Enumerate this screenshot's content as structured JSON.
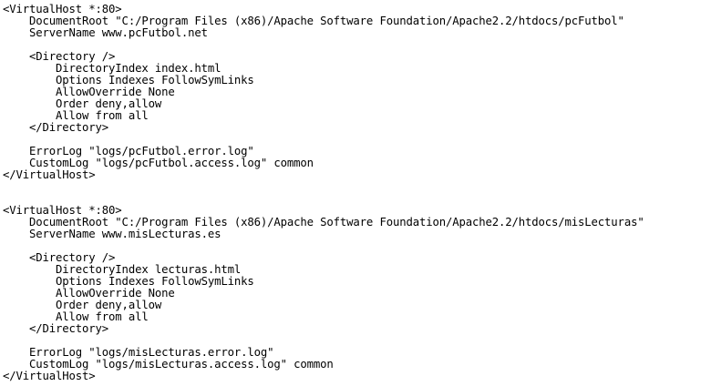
{
  "editor": {
    "lines": [
      "<VirtualHost *:80>",
      "    DocumentRoot \"C:/Program Files (x86)/Apache Software Foundation/Apache2.2/htdocs/pcFutbol\"",
      "    ServerName www.pcFutbol.net",
      "",
      "    <Directory />",
      "        DirectoryIndex index.html",
      "        Options Indexes FollowSymLinks",
      "        AllowOverride None",
      "        Order deny,allow",
      "        Allow from all",
      "    </Directory>",
      "",
      "    ErrorLog \"logs/pcFutbol.error.log\"",
      "    CustomLog \"logs/pcFutbol.access.log\" common",
      "</VirtualHost>",
      "",
      "",
      "<VirtualHost *:80>",
      "    DocumentRoot \"C:/Program Files (x86)/Apache Software Foundation/Apache2.2/htdocs/misLecturas\"",
      "    ServerName www.misLecturas.es",
      "",
      "    <Directory />",
      "        DirectoryIndex lecturas.html",
      "        Options Indexes FollowSymLinks",
      "        AllowOverride None",
      "        Order deny,allow",
      "        Allow from all",
      "    </Directory>",
      "",
      "    ErrorLog \"logs/misLecturas.error.log\"",
      "    CustomLog \"logs/misLecturas.access.log\" common",
      "</VirtualHost>"
    ]
  }
}
